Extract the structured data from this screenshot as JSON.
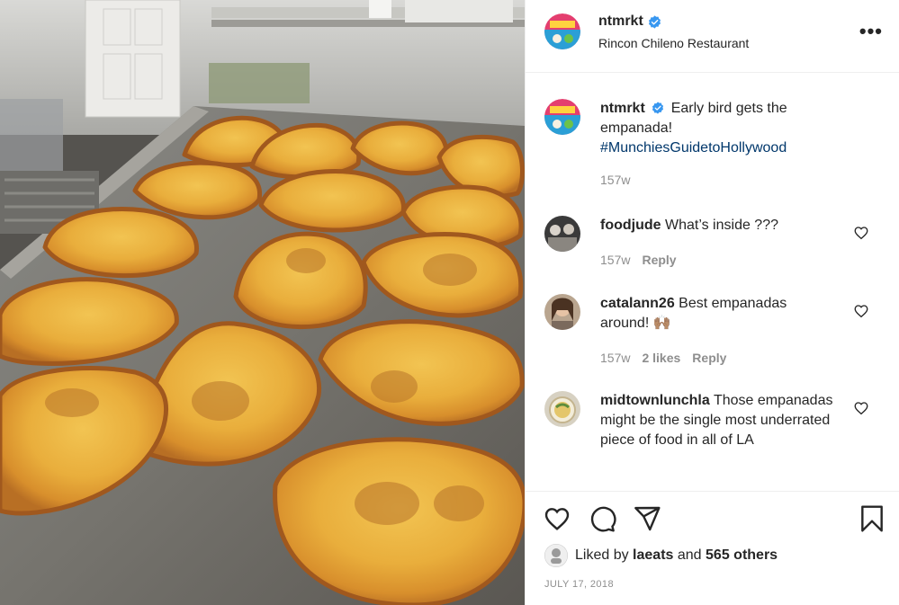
{
  "post": {
    "username": "ntmrkt",
    "location": "Rincon Chileno Restaurant",
    "more_label": "•••"
  },
  "caption": {
    "username": "ntmrkt",
    "text": "Early bird gets the empanada!",
    "hashtag": "#MunchiesGuidetoHollywood",
    "age": "157w"
  },
  "comments": [
    {
      "username": "foodjude",
      "text": "What’s inside ???",
      "age": "157w",
      "likes": "",
      "reply": "Reply"
    },
    {
      "username": "catalann26",
      "text": "Best empanadas around!",
      "emoji": "🙌🏽",
      "age": "157w",
      "likes": "2 likes",
      "reply": "Reply"
    },
    {
      "username": "midtownlunchla",
      "text": "Those empanadas might be the single most underrated piece of food in all of LA",
      "age": "",
      "likes": "",
      "reply": ""
    }
  ],
  "likes": {
    "prefix": "Liked by",
    "user": "laeats",
    "middle": "and",
    "others": "565 others"
  },
  "date": "JULY 17, 2018",
  "icons": [
    "verified-badge-icon",
    "more-options-icon",
    "heart-icon",
    "comment-icon",
    "share-icon",
    "bookmark-icon"
  ],
  "colors": {
    "verified": "#3897f0",
    "hashtag": "#00376b",
    "muted": "#8e8e8e",
    "text": "#262626",
    "divider": "#efefef"
  }
}
